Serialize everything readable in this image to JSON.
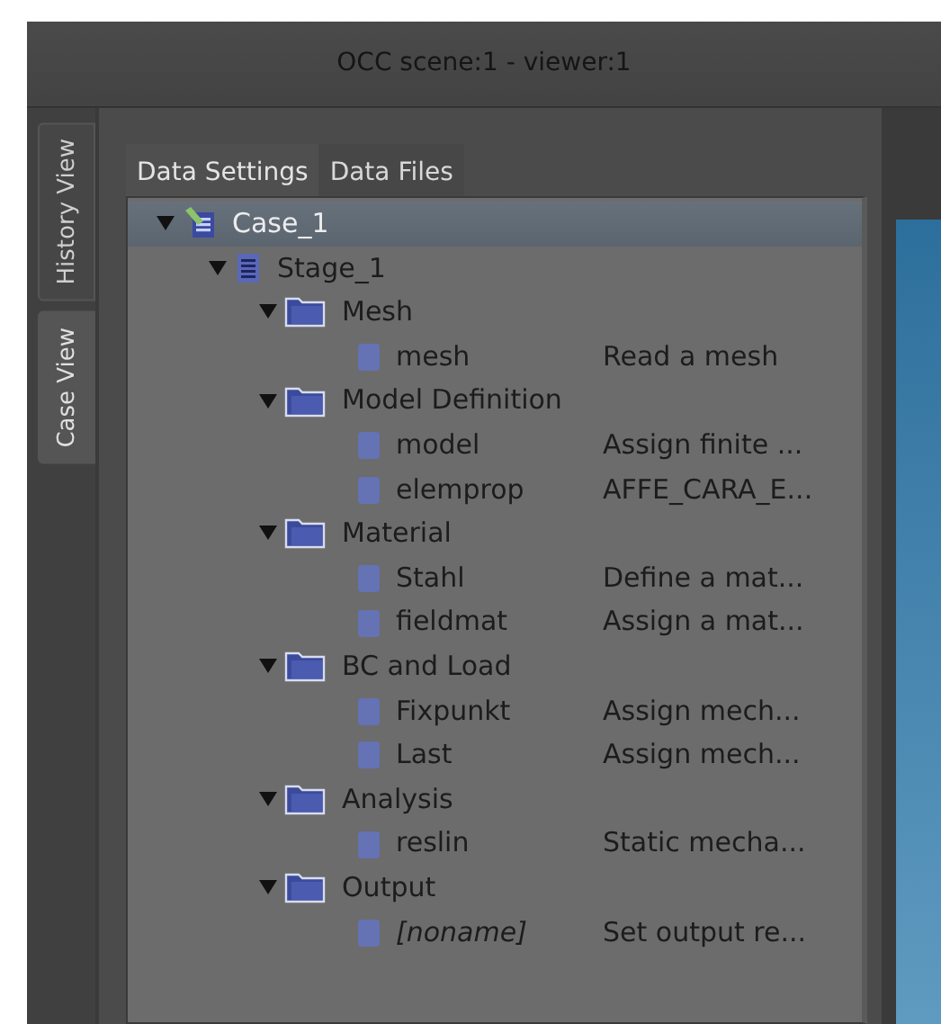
{
  "window": {
    "title": "OCC scene:1 - viewer:1"
  },
  "side_tabs": [
    {
      "label": "History View",
      "selected": false
    },
    {
      "label": "Case View",
      "selected": true
    }
  ],
  "tabs": [
    {
      "label": "Data Settings",
      "selected": true
    },
    {
      "label": "Data Files",
      "selected": false
    }
  ],
  "tree": [
    {
      "kind": "case",
      "name": "Case_1",
      "selected": true,
      "expanded": true,
      "children": [
        {
          "kind": "stage",
          "name": "Stage_1",
          "selected": false,
          "expanded": true,
          "children": [
            {
              "kind": "folder",
              "name": "Mesh",
              "selected": false,
              "expanded": true,
              "children": [
                {
                  "kind": "item",
                  "name": "mesh",
                  "description": "Read a mesh",
                  "italic": false,
                  "selected": false
                }
              ]
            },
            {
              "kind": "folder",
              "name": "Model Definition",
              "selected": false,
              "expanded": true,
              "children": [
                {
                  "kind": "item",
                  "name": "model",
                  "description": "Assign finite ...",
                  "italic": false,
                  "selected": false
                },
                {
                  "kind": "item",
                  "name": "elemprop",
                  "description": "AFFE_CARA_E...",
                  "italic": false,
                  "selected": false
                }
              ]
            },
            {
              "kind": "folder",
              "name": "Material",
              "selected": false,
              "expanded": true,
              "children": [
                {
                  "kind": "item",
                  "name": "Stahl",
                  "description": "Define a mat...",
                  "italic": false,
                  "selected": false
                },
                {
                  "kind": "item",
                  "name": "fieldmat",
                  "description": "Assign a mat...",
                  "italic": false,
                  "selected": false
                }
              ]
            },
            {
              "kind": "folder",
              "name": "BC and Load",
              "selected": false,
              "expanded": true,
              "children": [
                {
                  "kind": "item",
                  "name": "Fixpunkt",
                  "description": "Assign mech...",
                  "italic": false,
                  "selected": false
                },
                {
                  "kind": "item",
                  "name": "Last",
                  "description": "Assign mech...",
                  "italic": false,
                  "selected": false
                }
              ]
            },
            {
              "kind": "folder",
              "name": "Analysis",
              "selected": false,
              "expanded": true,
              "children": [
                {
                  "kind": "item",
                  "name": "reslin",
                  "description": "Static mecha...",
                  "italic": false,
                  "selected": false
                }
              ]
            },
            {
              "kind": "folder",
              "name": "Output",
              "selected": false,
              "expanded": true,
              "children": [
                {
                  "kind": "item",
                  "name": "[noname]",
                  "description": "Set output re...",
                  "italic": true,
                  "selected": false
                }
              ]
            }
          ]
        }
      ]
    }
  ]
}
